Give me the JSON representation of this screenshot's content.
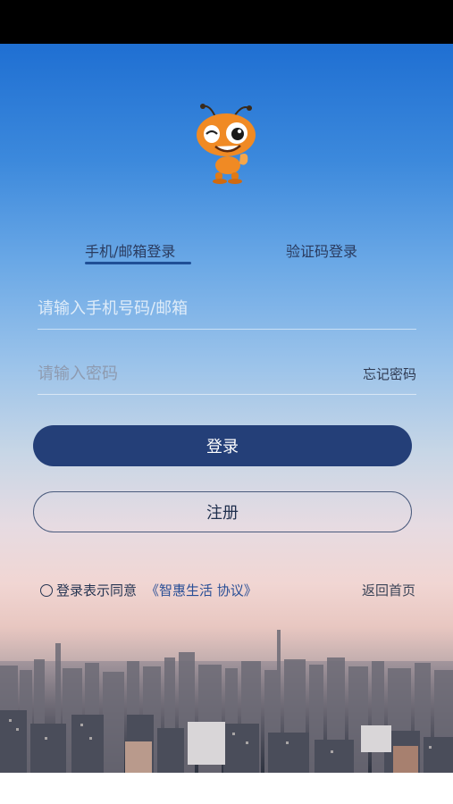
{
  "tabs": {
    "phone_email": "手机/邮箱登录",
    "code": "验证码登录"
  },
  "inputs": {
    "account_placeholder": "请输入手机号码/邮箱",
    "password_placeholder": "请输入密码"
  },
  "forgot_password": "忘记密码",
  "buttons": {
    "login": "登录",
    "register": "注册"
  },
  "agreement": {
    "text": "登录表示同意",
    "link": "《智惠生活 协议》"
  },
  "back_home": "返回首页",
  "colors": {
    "accent": "#243f78",
    "link": "#2a4f96"
  }
}
